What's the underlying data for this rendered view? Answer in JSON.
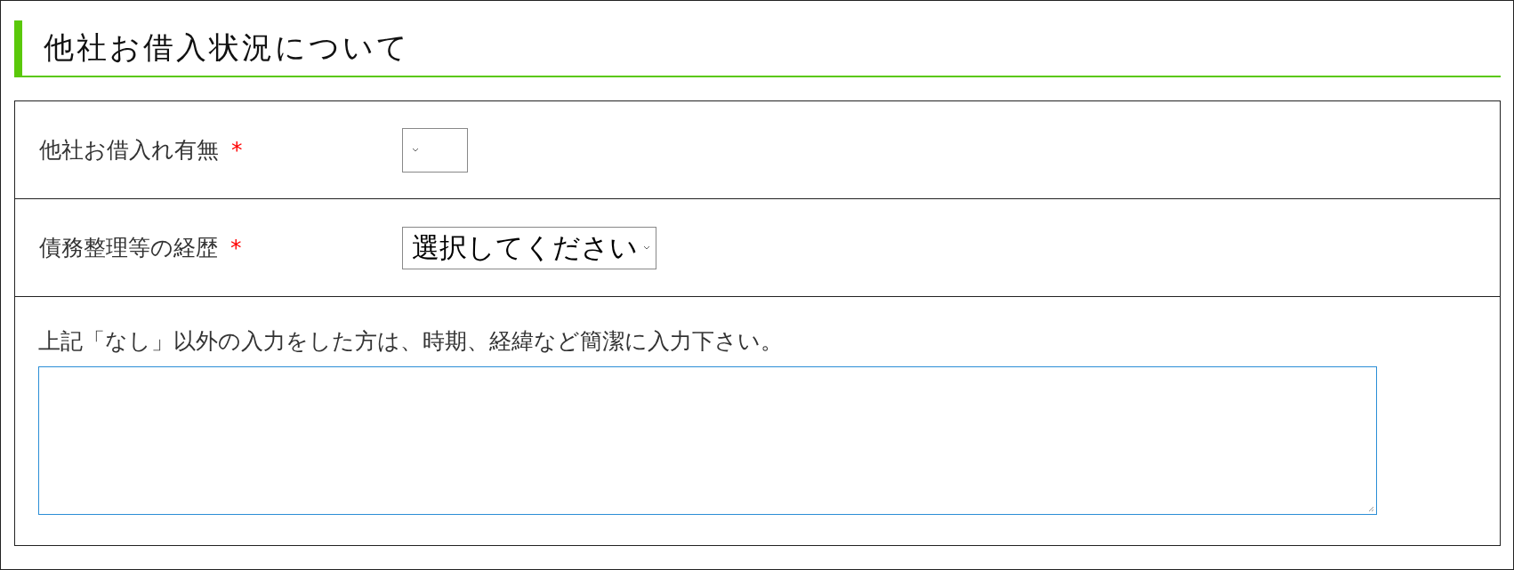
{
  "section": {
    "title": "他社お借入状況について"
  },
  "fields": [
    {
      "kind": "select",
      "label": "他社お借入れ有無",
      "required_mark": "*"
    },
    {
      "kind": "select",
      "label": "債務整理等の経歴",
      "required_mark": "*",
      "value": "選択してください"
    },
    {
      "kind": "textarea",
      "label": "上記「なし」以外の入力をした方は、時期、経緯など簡潔に入力下さい。"
    }
  ]
}
